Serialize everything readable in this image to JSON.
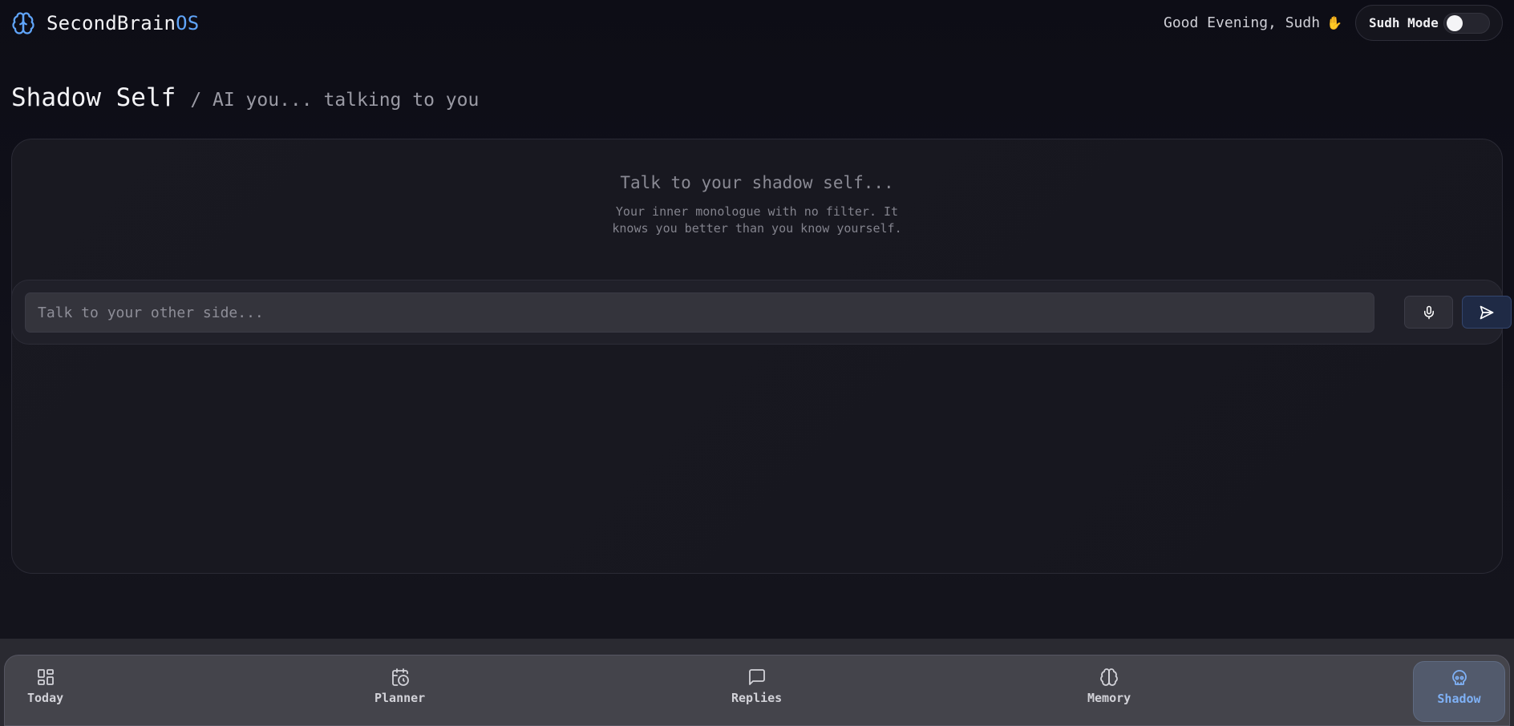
{
  "header": {
    "brand": "SecondBrain",
    "brand_accent": "OS",
    "greeting": "Good Evening, Sudh",
    "greeting_icon": "waving-hand-icon",
    "mode_label": "Sudh Mode",
    "mode_enabled": false
  },
  "page": {
    "title": "Shadow Self",
    "subtitle": "/ AI you... talking to you"
  },
  "chat": {
    "empty_title": "Talk to your shadow self...",
    "empty_description": "Your inner monologue with no filter. It knows you better than you know yourself.",
    "input_placeholder": "Talk to your other side...",
    "input_value": "",
    "mic_icon": "microphone-icon",
    "send_icon": "send-icon"
  },
  "nav": {
    "items": [
      {
        "label": "Today",
        "icon": "dashboard-grid-icon",
        "active": false
      },
      {
        "label": "Planner",
        "icon": "calendar-clock-icon",
        "active": false
      },
      {
        "label": "Replies",
        "icon": "chat-bubble-icon",
        "active": false
      },
      {
        "label": "Memory",
        "icon": "brain-icon",
        "active": false
      },
      {
        "label": "Shadow",
        "icon": "skull-icon",
        "active": true
      }
    ]
  },
  "colors": {
    "accent": "#60a5fa",
    "background": "#0d0d16",
    "active_nav_label": "#7fb1f6"
  }
}
